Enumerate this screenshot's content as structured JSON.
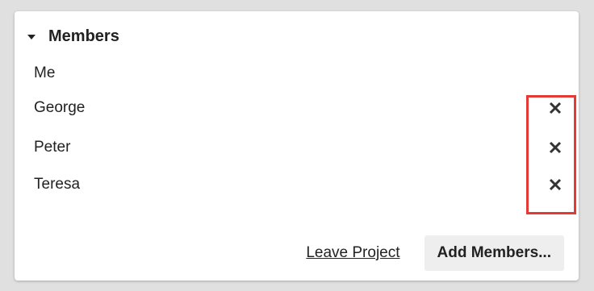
{
  "panel": {
    "title": "Members",
    "toggle_icon": "caret-down-icon"
  },
  "members": [
    {
      "name": "Me",
      "removable": false
    },
    {
      "name": "George",
      "removable": true,
      "remove_icon": "close-icon"
    },
    {
      "name": "Peter",
      "removable": true,
      "remove_icon": "close-icon"
    },
    {
      "name": "Teresa",
      "removable": true,
      "remove_icon": "close-icon"
    }
  ],
  "footer": {
    "leave_label": "Leave Project",
    "add_label": "Add Members..."
  },
  "colors": {
    "highlight": "#e53935",
    "text": "#222222",
    "button_bg": "#eeeeee"
  }
}
